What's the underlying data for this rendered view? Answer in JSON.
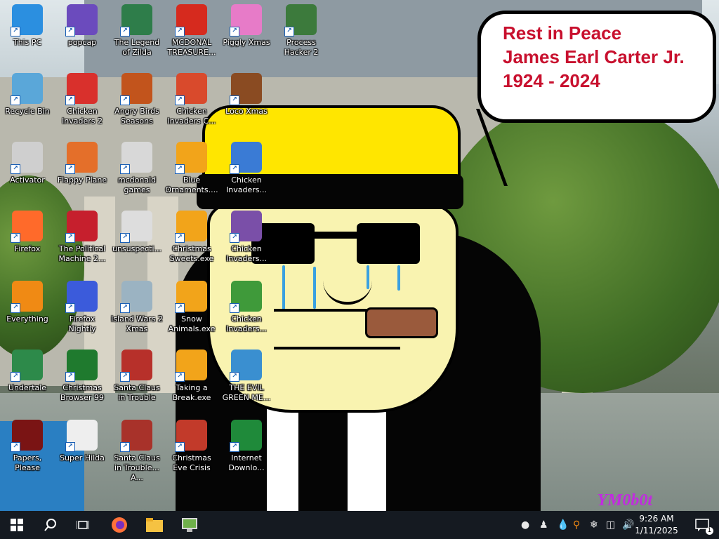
{
  "desktop": {
    "icons": [
      {
        "label": "This PC",
        "icon": "this-pc-icon",
        "color": "#2b8fe0"
      },
      {
        "label": "popcap",
        "icon": "popcap-folder-icon",
        "color": "#6b4bbd"
      },
      {
        "label": "The Legend of Zilda",
        "icon": "legend-of-zilda-icon",
        "color": "#2e7d4a"
      },
      {
        "label": "MCDONAL TREASURE...",
        "icon": "mcdonalds-icon",
        "color": "#d62a1e"
      },
      {
        "label": "Piggly Xmas",
        "icon": "piggly-xmas-icon",
        "color": "#e77bc8"
      },
      {
        "label": "Process Hacker 2",
        "icon": "process-hacker-icon",
        "color": "#3c7a3c"
      },
      {
        "label": "Recycle Bin",
        "icon": "recycle-bin-icon",
        "color": "#5aa7d9"
      },
      {
        "label": "Chicken Invaders 2",
        "icon": "chicken-invaders-icon",
        "color": "#d9302c"
      },
      {
        "label": "Angry Birds Seasons",
        "icon": "angry-birds-icon",
        "color": "#c2541c"
      },
      {
        "label": "Chicken Invaders C...",
        "icon": "chicken-invaders-c-icon",
        "color": "#d94a2c"
      },
      {
        "label": "Loco Xmas",
        "icon": "loco-xmas-icon",
        "color": "#8a4b22"
      },
      {
        "label": "Activator",
        "icon": "activator-icon",
        "color": "#cfcfcf"
      },
      {
        "label": "Flappy Plane",
        "icon": "flappy-plane-icon",
        "color": "#e46f2a"
      },
      {
        "label": "mcdonald games",
        "icon": "mcdonald-games-icon",
        "color": "#d8d8d8"
      },
      {
        "label": "Blue Ornaments....",
        "icon": "blue-ornaments-icon",
        "color": "#f2a41a"
      },
      {
        "label": "Chicken Invaders...",
        "icon": "chicken-invaders-xmas-icon",
        "color": "#3a7bd5"
      },
      {
        "label": "Firefox",
        "icon": "firefox-icon",
        "color": "#ff6a2a"
      },
      {
        "label": "The Political Machine 2...",
        "icon": "political-machine-icon",
        "color": "#c61f2d"
      },
      {
        "label": "unsuspecti...",
        "icon": "unsuspecting-icon",
        "color": "#dddddd"
      },
      {
        "label": "Christmas Sweets.exe",
        "icon": "christmas-sweets-icon",
        "color": "#f2a41a"
      },
      {
        "label": "Chicken Invaders...",
        "icon": "chicken-invaders-3-icon",
        "color": "#7a4fa8"
      },
      {
        "label": "Everything",
        "icon": "everything-search-icon",
        "color": "#f08a14"
      },
      {
        "label": "Firefox Nightly",
        "icon": "firefox-nightly-icon",
        "color": "#3b5bdb"
      },
      {
        "label": "Island Wars 2 Xmas",
        "icon": "island-wars-icon",
        "color": "#9bb3c2"
      },
      {
        "label": "Snow Animals.exe",
        "icon": "snow-animals-icon",
        "color": "#f2a41a"
      },
      {
        "label": "Chicken Invaders...",
        "icon": "chicken-invaders-4-icon",
        "color": "#3f9a3a"
      },
      {
        "label": "Undertale",
        "icon": "undertale-icon",
        "color": "#2d8a4a"
      },
      {
        "label": "Christmas Browser 99",
        "icon": "christmas-browser-icon",
        "color": "#1f7a2e"
      },
      {
        "label": "Santa Claus in Trouble",
        "icon": "santa-claus-trouble-icon",
        "color": "#b7302a"
      },
      {
        "label": "Taking a Break.exe",
        "icon": "taking-a-break-icon",
        "color": "#f2a41a"
      },
      {
        "label": "THE EVIL GREEN ME...",
        "icon": "evil-green-me-icon",
        "color": "#3a8fd0"
      },
      {
        "label": "Papers, Please",
        "icon": "papers-please-icon",
        "color": "#7a1414"
      },
      {
        "label": "Super Hilda",
        "icon": "super-hilda-icon",
        "color": "#eeeeee"
      },
      {
        "label": "Santa Claus in Trouble... A...",
        "icon": "santa-claus-trouble-a-icon",
        "color": "#a8322a"
      },
      {
        "label": "Christmas Eve Crisis",
        "icon": "christmas-eve-crisis-icon",
        "color": "#c23a2a"
      },
      {
        "label": "Internet Downlo...",
        "icon": "internet-download-icon",
        "color": "#1f8a3a"
      }
    ]
  },
  "wallpaper": {
    "bubble": [
      "Rest in Peace",
      "James Earl Carter Jr.",
      "1924 - 2024"
    ],
    "bubble_color": "#c8102e",
    "watermark": "YM0b0t"
  },
  "taskbar": {
    "time": "9:26 AM",
    "date": "1/11/2025",
    "notification_count": "1"
  }
}
